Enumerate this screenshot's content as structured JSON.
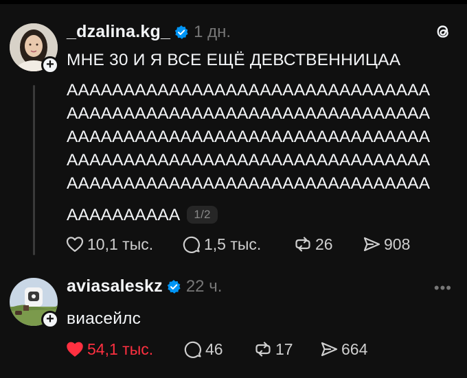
{
  "post1": {
    "username": "_dzalina.kg_",
    "time": "1 дн.",
    "lines": [
      "МНЕ 30 И Я ВСЕ ЕЩЁ ДЕВСТВЕННИЦАА",
      "АААААААААААААААААААААААААААААААА",
      "АААААААААААААААААААААААААААААААА",
      "АААААААААААААААААААААААААААААААА",
      "АААААААААААААААААААААААААААААААА",
      "АААААААААААААААААААААААААААААААА",
      "АААААААААА"
    ],
    "page_indicator": "1/2",
    "likes": "10,1 тыс.",
    "replies": "1,5 тыс.",
    "reposts": "26",
    "shares": "908"
  },
  "post2": {
    "username": "aviasaleskz",
    "time": "22 ч.",
    "text": "виасейлс",
    "likes": "54,1 тыс.",
    "replies": "46",
    "reposts": "17",
    "shares": "664"
  },
  "colors": {
    "background": "#101010",
    "text": "#f3f5f7",
    "muted": "#777777",
    "liked": "#ff3040",
    "verified": "#0095f6"
  },
  "icons": [
    "threads-logo-icon",
    "heart-icon",
    "reply-icon",
    "repost-icon",
    "share-icon",
    "verified-icon",
    "more-icon",
    "plus-icon"
  ]
}
